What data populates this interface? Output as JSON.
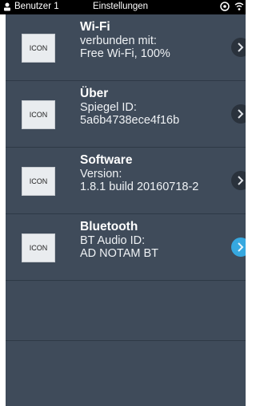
{
  "status_bar": {
    "user_label": "Benutzer 1",
    "title": "Einstellungen"
  },
  "settings": [
    {
      "icon_label": "ICON",
      "title": "Wi-Fi",
      "line1": "verbunden mit:",
      "line2": "Free Wi-Fi, 100%"
    },
    {
      "icon_label": "ICON",
      "title": "Über",
      "line1": "Spiegel ID:",
      "line2": "5a6b4738ece4f16b"
    },
    {
      "icon_label": "ICON",
      "title": "Software",
      "line1": "Version:",
      "line2": "1.8.1 build 20160718-2"
    },
    {
      "icon_label": "ICON",
      "title": "Bluetooth",
      "line1": "BT Audio ID:",
      "line2": "AD NOTAM BT"
    }
  ],
  "colors": {
    "panel_bg": "#3f4b5a",
    "chevron_inactive": "#2a323c",
    "chevron_active": "#36a8e0"
  }
}
